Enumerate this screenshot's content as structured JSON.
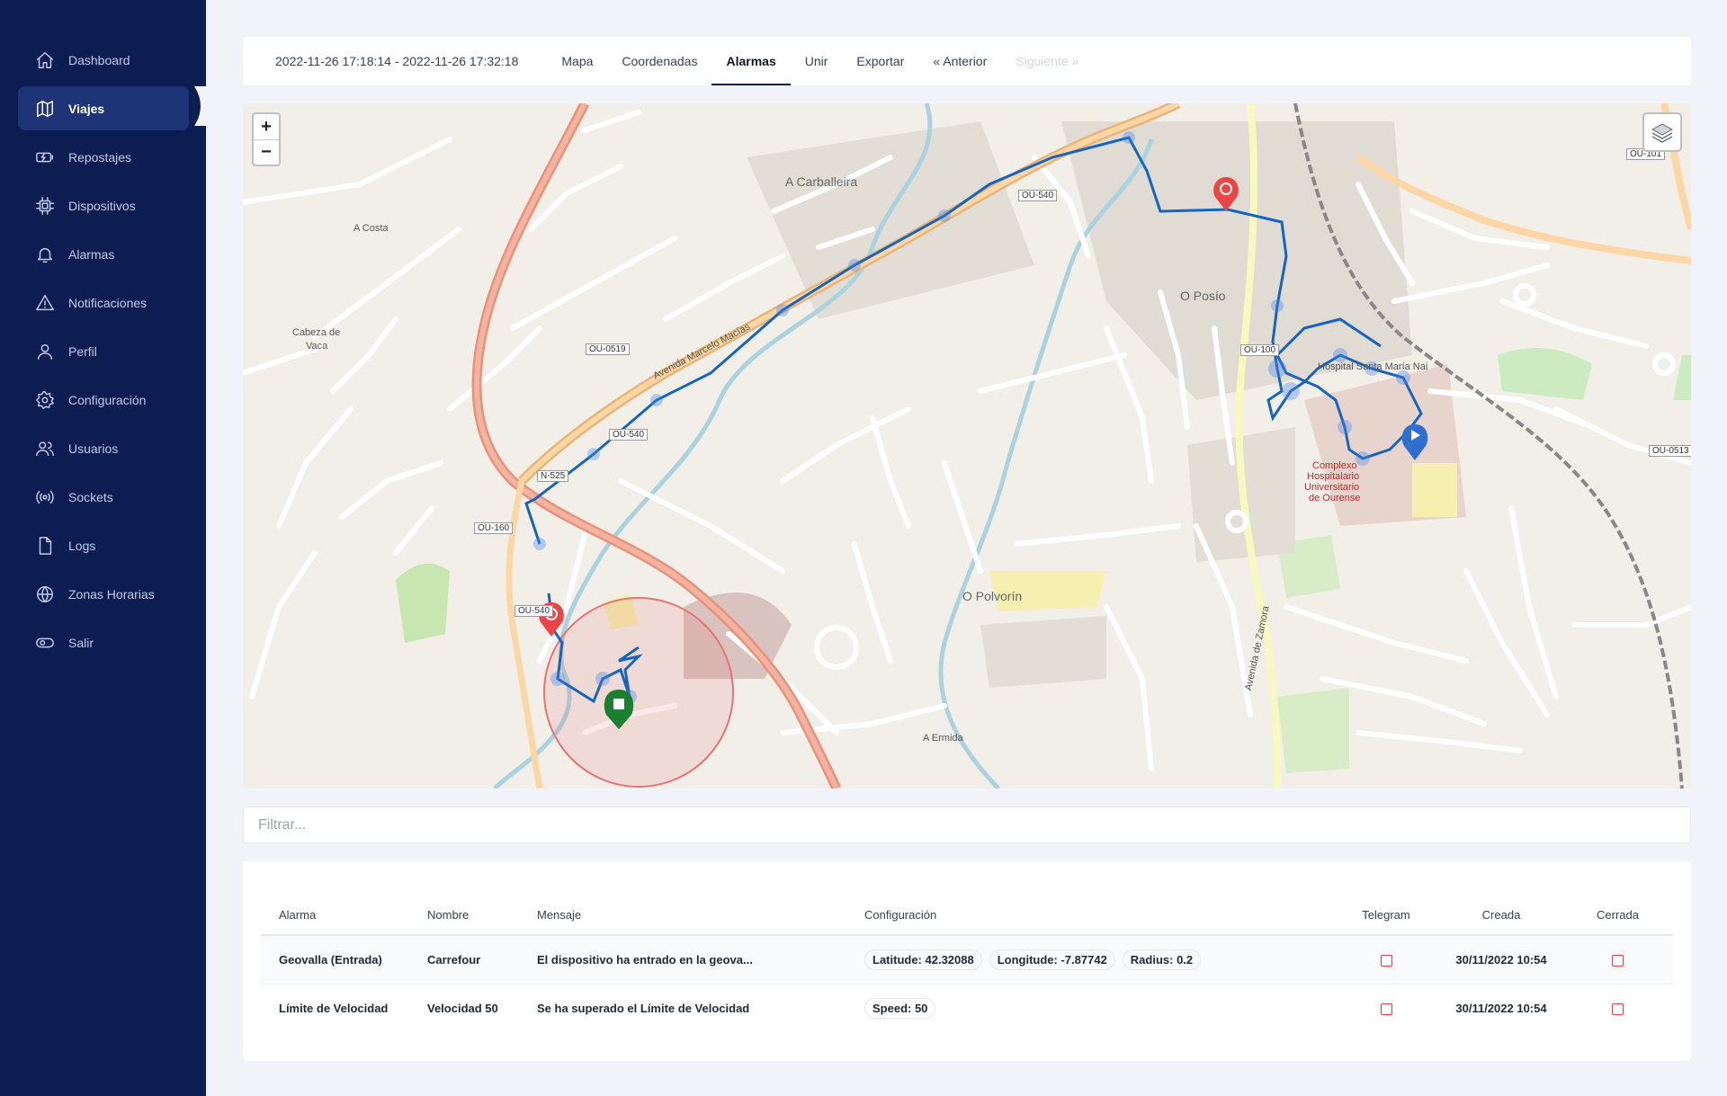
{
  "sidebar": {
    "items": [
      {
        "label": "Dashboard",
        "icon": "home-icon",
        "active": false
      },
      {
        "label": "Viajes",
        "icon": "map-icon",
        "active": true
      },
      {
        "label": "Repostajes",
        "icon": "fuel-battery-icon",
        "active": false
      },
      {
        "label": "Dispositivos",
        "icon": "chip-icon",
        "active": false
      },
      {
        "label": "Alarmas",
        "icon": "bell-icon",
        "active": false
      },
      {
        "label": "Notificaciones",
        "icon": "warning-icon",
        "active": false
      },
      {
        "label": "Perfil",
        "icon": "user-icon",
        "active": false
      },
      {
        "label": "Configuración",
        "icon": "gear-icon",
        "active": false
      },
      {
        "label": "Usuarios",
        "icon": "users-icon",
        "active": false
      },
      {
        "label": "Sockets",
        "icon": "broadcast-icon",
        "active": false
      },
      {
        "label": "Logs",
        "icon": "document-icon",
        "active": false
      },
      {
        "label": "Zonas Horarias",
        "icon": "globe-icon",
        "active": false
      },
      {
        "label": "Salir",
        "icon": "toggle-icon",
        "active": false
      }
    ]
  },
  "tabs": {
    "range": "2022-11-26 17:18:14 - 2022-11-26 17:32:18",
    "mapa": "Mapa",
    "coordenadas": "Coordenadas",
    "alarmas": "Alarmas",
    "unir": "Unir",
    "exportar": "Exportar",
    "anterior": "« Anterior",
    "siguiente": "Siguiente »"
  },
  "map": {
    "zoom_in": "+",
    "zoom_out": "−",
    "labels": {
      "carballeira": "A Carballeira",
      "posio": "O Posío",
      "polvorin": "O Polvorín",
      "costa": "A Costa",
      "cabeza": "Cabeza de",
      "vaca": "Vaca",
      "ermida": "A Ermida",
      "hospital_1": "Complexo",
      "hospital_2": "Hospitalario",
      "hospital_3": "Universitario",
      "hospital_4": "de Ourense",
      "santa_maria": "Hospital Santa María Nai",
      "av_marcelo": "Avenida Marcelo Macías",
      "av_zamora": "Avenida de Zamora",
      "ou0519": "OU-0519",
      "ou540a": "OU-540",
      "ou540b": "OU-540",
      "ou540c": "OU-540",
      "ou160": "OU-160",
      "n525": "N-525",
      "ou0513": "OU-0513",
      "ou101": "OU-101",
      "ou100": "OU-100"
    },
    "colors": {
      "route": "#1565c0",
      "start_marker": "#1a7f2e",
      "end_marker": "#2f6fd1",
      "alarm_marker": "#ef4444",
      "geofence": "#e57373"
    }
  },
  "filter": {
    "placeholder": "Filtrar..."
  },
  "table": {
    "headers": {
      "alarma": "Alarma",
      "nombre": "Nombre",
      "mensaje": "Mensaje",
      "configuracion": "Configuración",
      "telegram": "Telegram",
      "creada": "Creada",
      "cerrada": "Cerrada"
    },
    "rows": [
      {
        "alarma": "Geovalla (Entrada)",
        "nombre": "Carrefour",
        "mensaje": "El dispositivo ha entrado en la geova...",
        "config": [
          "Latitude: 42.32088",
          "Longitude: -7.87742",
          "Radius: 0.2"
        ],
        "telegram": false,
        "creada": "30/11/2022 10:54",
        "cerrada": false
      },
      {
        "alarma": "Límite de Velocidad",
        "nombre": "Velocidad 50",
        "mensaje": "Se ha superado el Límite de Velocidad",
        "config": [
          "Speed: 50"
        ],
        "telegram": false,
        "creada": "30/11/2022 10:54",
        "cerrada": false
      }
    ]
  }
}
